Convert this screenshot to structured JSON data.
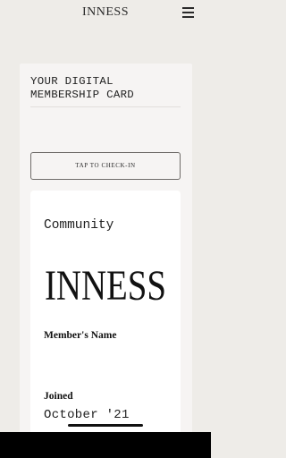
{
  "header": {
    "brand": "INNESS",
    "menu_icon": "hamburger-menu-icon"
  },
  "card": {
    "heading": "YOUR DIGITAL MEMBERSHIP CARD",
    "checkin_label": "TAP TO CHECK-IN"
  },
  "membership": {
    "tier": "Community",
    "logo_text": "INNESS",
    "member_name_label": "Member's Name",
    "member_name_value": "",
    "joined_label": "Joined",
    "joined_value": "October '21"
  }
}
